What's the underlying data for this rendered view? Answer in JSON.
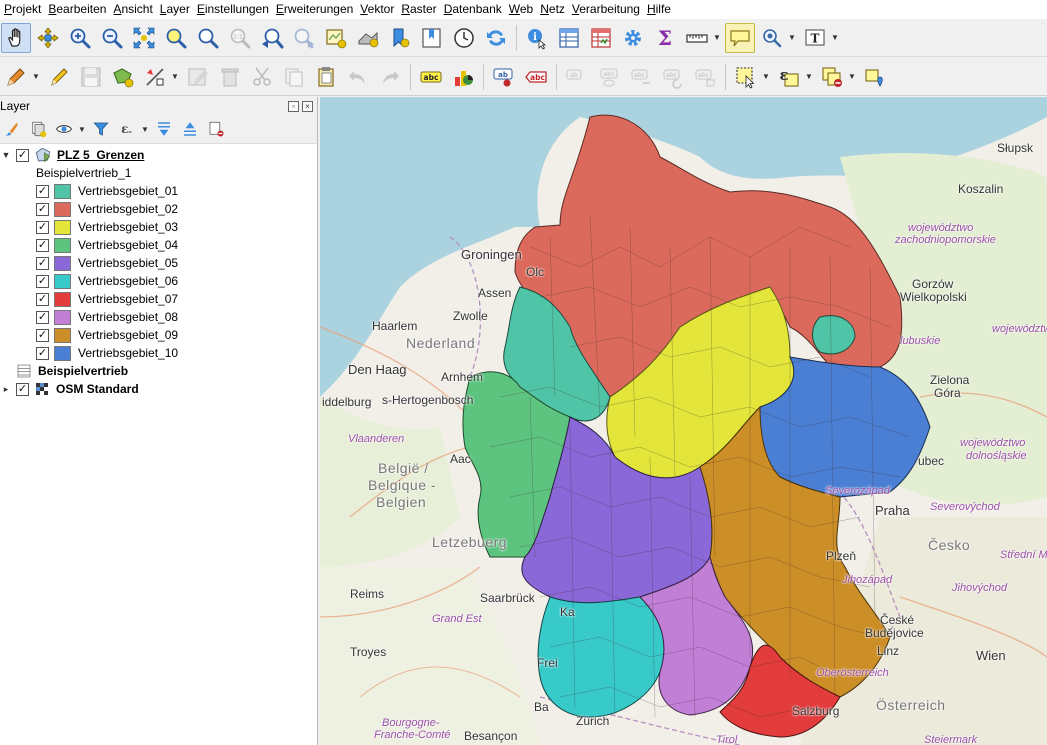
{
  "menu": [
    "Projekt",
    "Bearbeiten",
    "Ansicht",
    "Layer",
    "Einstellungen",
    "Erweiterungen",
    "Vektor",
    "Raster",
    "Datenbank",
    "Web",
    "Netz",
    "Verarbeitung",
    "Hilfe"
  ],
  "panel": {
    "title": "Layer"
  },
  "layers": {
    "root": {
      "name": "PLZ 5_Grenzen"
    },
    "field": "Beispielvertrieb_1",
    "classes": [
      {
        "label": "Vertriebsgebiet_01",
        "color": "#4fc4a6"
      },
      {
        "label": "Vertriebsgebiet_02",
        "color": "#dc6a5c"
      },
      {
        "label": "Vertriebsgebiet_03",
        "color": "#e3e53a"
      },
      {
        "label": "Vertriebsgebiet_04",
        "color": "#5cc47f"
      },
      {
        "label": "Vertriebsgebiet_05",
        "color": "#8a68d8"
      },
      {
        "label": "Vertriebsgebiet_06",
        "color": "#38c9c9"
      },
      {
        "label": "Vertriebsgebiet_07",
        "color": "#e23c3c"
      },
      {
        "label": "Vertriebsgebiet_08",
        "color": "#c27fd6"
      },
      {
        "label": "Vertriebsgebiet_09",
        "color": "#cc8e26"
      },
      {
        "label": "Vertriebsgebiet_10",
        "color": "#4a7fd3"
      }
    ],
    "table": {
      "name": "Beispielvertrieb"
    },
    "basemap": {
      "name": "OSM Standard"
    }
  },
  "map": {
    "labels": [
      {
        "text": "Słupsk",
        "cls": ""
      },
      {
        "text": "Koszalin",
        "cls": ""
      },
      {
        "text": "województwo",
        "cls": "region"
      },
      {
        "text": "zachodniopomorskie",
        "cls": "region"
      },
      {
        "text": "Gorzów",
        "cls": ""
      },
      {
        "text": "Wielkopolski",
        "cls": ""
      },
      {
        "text": "województwo",
        "cls": "region"
      },
      {
        "text": "lubuskie",
        "cls": "region"
      },
      {
        "text": "Zielona",
        "cls": ""
      },
      {
        "text": "Góra",
        "cls": ""
      },
      {
        "text": "województwo",
        "cls": "region"
      },
      {
        "text": "dolnośląskie",
        "cls": "region"
      },
      {
        "text": "Groningen",
        "cls": "big"
      },
      {
        "text": "Assen",
        "cls": ""
      },
      {
        "text": "Zwolle",
        "cls": ""
      },
      {
        "text": "Haarlem",
        "cls": ""
      },
      {
        "text": "Nederland",
        "cls": "country"
      },
      {
        "text": "Den Haag",
        "cls": "big"
      },
      {
        "text": "Arnhem",
        "cls": ""
      },
      {
        "text": "s-Hertogenbosch",
        "cls": ""
      },
      {
        "text": "iddelburg",
        "cls": ""
      },
      {
        "text": "Vlaanderen",
        "cls": "region"
      },
      {
        "text": "België /",
        "cls": "country"
      },
      {
        "text": "Belgique -",
        "cls": "country"
      },
      {
        "text": "Belgien",
        "cls": "country"
      },
      {
        "text": "Letzebuerg",
        "cls": "country"
      },
      {
        "text": "Reims",
        "cls": ""
      },
      {
        "text": "Grand Est",
        "cls": "region"
      },
      {
        "text": "Troyes",
        "cls": ""
      },
      {
        "text": "Bourgogne-",
        "cls": "region"
      },
      {
        "text": "Franche-Comté",
        "cls": "region"
      },
      {
        "text": "Besançon",
        "cls": ""
      },
      {
        "text": "Saarbrück",
        "cls": ""
      },
      {
        "text": "Zürich",
        "cls": ""
      },
      {
        "text": "Severozápad",
        "cls": "region"
      },
      {
        "text": "Severovýchod",
        "cls": "region"
      },
      {
        "text": "Praha",
        "cls": "big"
      },
      {
        "text": "Česko",
        "cls": "country"
      },
      {
        "text": "Střední M",
        "cls": "region"
      },
      {
        "text": "Plzeň",
        "cls": ""
      },
      {
        "text": "Jihozápad",
        "cls": "region"
      },
      {
        "text": "Jihovýchod",
        "cls": "region"
      },
      {
        "text": "České",
        "cls": ""
      },
      {
        "text": "Budějovice",
        "cls": ""
      },
      {
        "text": "Linz",
        "cls": ""
      },
      {
        "text": "Wien",
        "cls": "big"
      },
      {
        "text": "Oberösterreich",
        "cls": "region"
      },
      {
        "text": "Österreich",
        "cls": "country"
      },
      {
        "text": "Salzburg",
        "cls": ""
      },
      {
        "text": "Tirol",
        "cls": "region"
      },
      {
        "text": "Steiermark",
        "cls": "region"
      },
      {
        "text": "Frei",
        "cls": ""
      },
      {
        "text": "Aac",
        "cls": ""
      },
      {
        "text": "Olc",
        "cls": ""
      },
      {
        "text": "Ka",
        "cls": ""
      },
      {
        "text": "Ba",
        "cls": ""
      },
      {
        "text": "ubec",
        "cls": ""
      }
    ]
  }
}
